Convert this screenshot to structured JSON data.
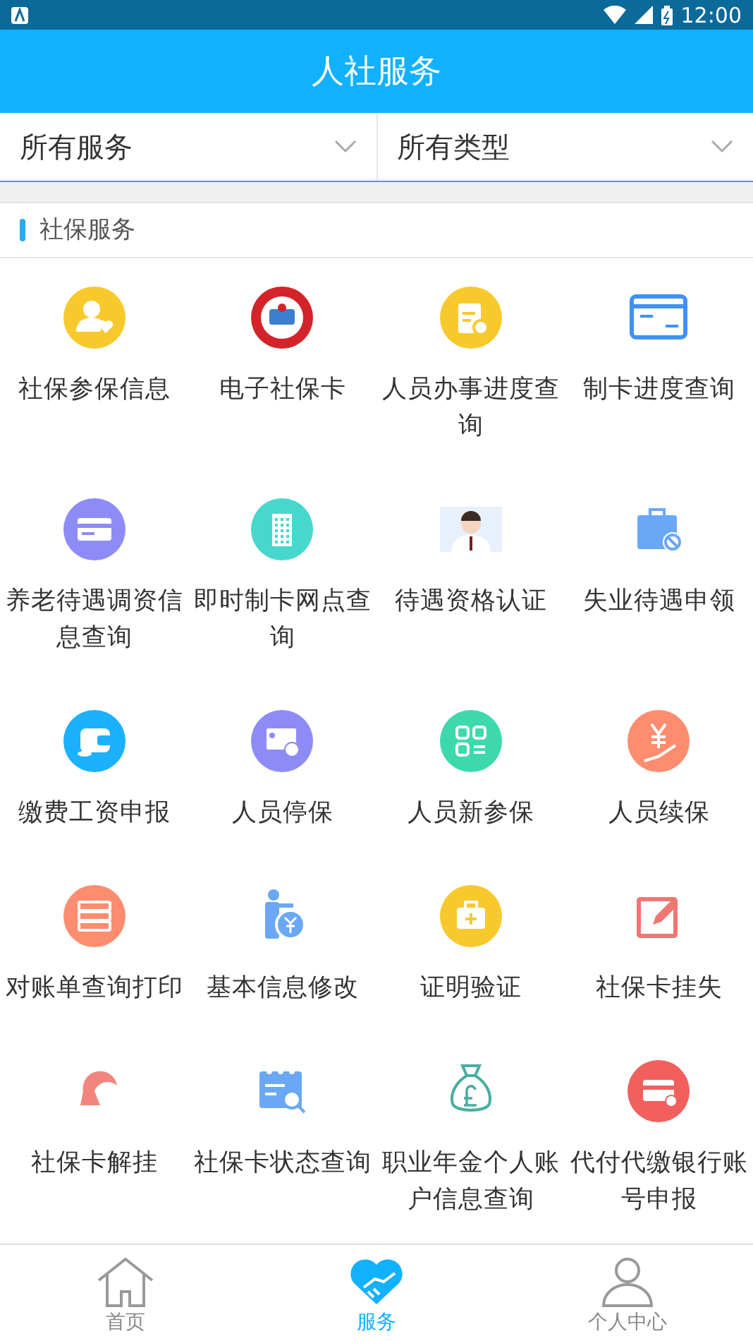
{
  "status_bar": {
    "time": "12:00"
  },
  "header": {
    "title": "人社服务"
  },
  "filters": [
    {
      "label": "所有服务"
    },
    {
      "label": "所有类型"
    }
  ],
  "section": {
    "title": "社保服务"
  },
  "services": [
    {
      "label": "社保参保信息"
    },
    {
      "label": "电子社保卡"
    },
    {
      "label": "人员办事进度查询"
    },
    {
      "label": "制卡进度查询"
    },
    {
      "label": "养老待遇调资信息查询"
    },
    {
      "label": "即时制卡网点查询"
    },
    {
      "label": "待遇资格认证"
    },
    {
      "label": "失业待遇申领"
    },
    {
      "label": "缴费工资申报"
    },
    {
      "label": "人员停保"
    },
    {
      "label": "人员新参保"
    },
    {
      "label": "人员续保"
    },
    {
      "label": "对账单查询打印"
    },
    {
      "label": "基本信息修改"
    },
    {
      "label": "证明验证"
    },
    {
      "label": "社保卡挂失"
    },
    {
      "label": "社保卡解挂"
    },
    {
      "label": "社保卡状态查询"
    },
    {
      "label": "职业年金个人账户信息查询"
    },
    {
      "label": "代付代缴银行账号申报"
    }
  ],
  "tabs": [
    {
      "label": "首页",
      "selected": false
    },
    {
      "label": "服务",
      "selected": true
    },
    {
      "label": "个人中心",
      "selected": false
    }
  ]
}
